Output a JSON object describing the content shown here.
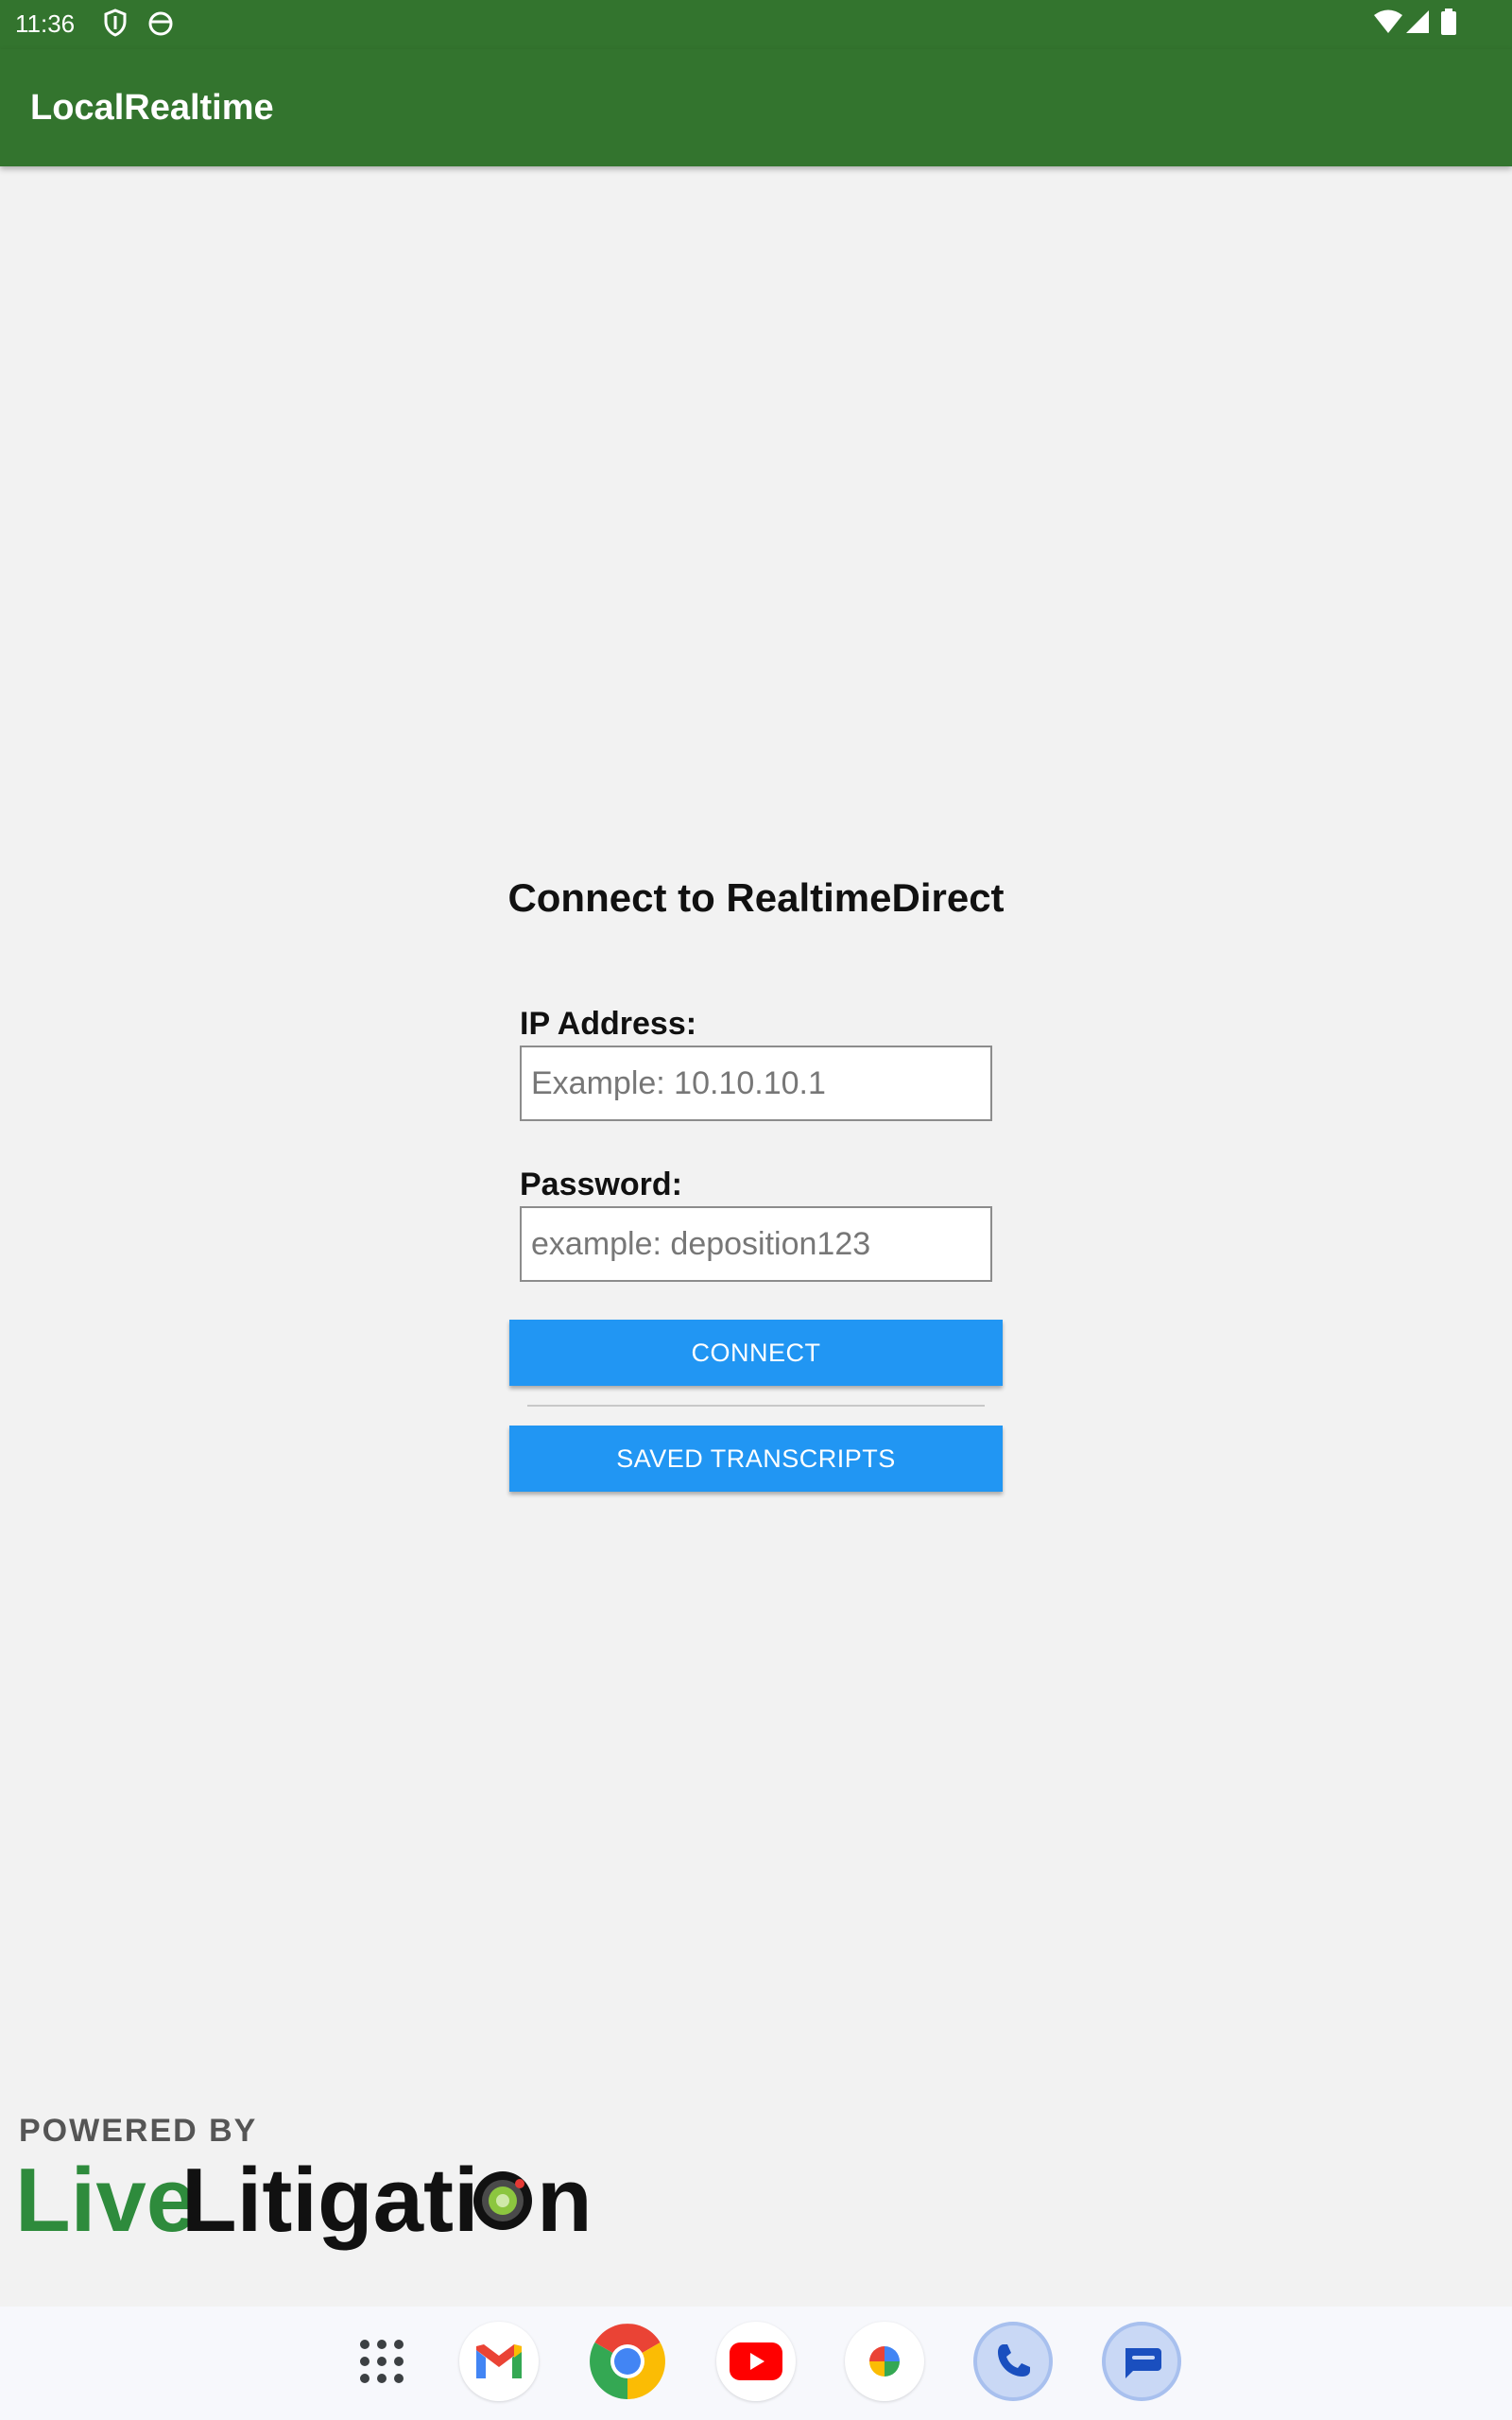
{
  "status_bar": {
    "time": "11:36",
    "left_icons": [
      "vpn-shield-icon",
      "android-debug-icon"
    ],
    "right_icons": [
      "wifi-icon",
      "cellular-signal-icon",
      "battery-icon"
    ]
  },
  "app_bar": {
    "title": "LocalRealtime",
    "color": "#33742e"
  },
  "form": {
    "title": "Connect to RealtimeDirect",
    "ip_label": "IP Address:",
    "ip_placeholder": "Example: 10.10.10.1",
    "ip_value": "",
    "password_label": "Password:",
    "password_placeholder": "example: deposition123",
    "password_value": "",
    "connect_label": "CONNECT",
    "saved_transcripts_label": "SAVED TRANSCRIPTS",
    "button_color": "#2196f3"
  },
  "branding": {
    "powered_by": "POWERED BY",
    "logo_part1": "Live",
    "logo_part2": "Litigati",
    "logo_part3": "n"
  },
  "taskbar": {
    "apps": [
      "app-drawer-icon",
      "gmail-icon",
      "chrome-icon",
      "youtube-icon",
      "photos-icon",
      "phone-icon",
      "messages-icon"
    ]
  }
}
